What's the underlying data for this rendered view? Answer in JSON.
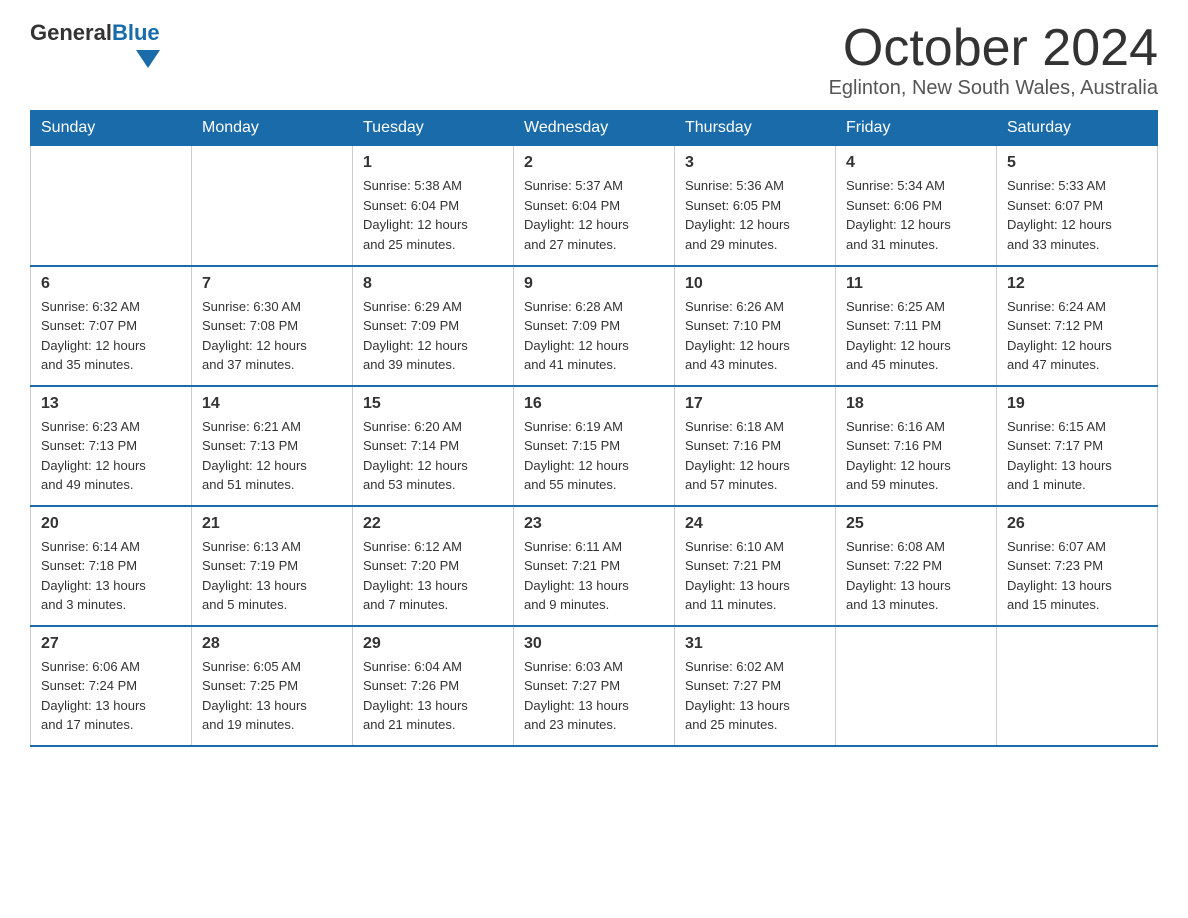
{
  "header": {
    "logo": {
      "general": "General",
      "blue": "Blue"
    },
    "title": "October 2024",
    "location": "Eglinton, New South Wales, Australia"
  },
  "calendar": {
    "days_of_week": [
      "Sunday",
      "Monday",
      "Tuesday",
      "Wednesday",
      "Thursday",
      "Friday",
      "Saturday"
    ],
    "weeks": [
      [
        {
          "day": "",
          "info": ""
        },
        {
          "day": "",
          "info": ""
        },
        {
          "day": "1",
          "info": "Sunrise: 5:38 AM\nSunset: 6:04 PM\nDaylight: 12 hours\nand 25 minutes."
        },
        {
          "day": "2",
          "info": "Sunrise: 5:37 AM\nSunset: 6:04 PM\nDaylight: 12 hours\nand 27 minutes."
        },
        {
          "day": "3",
          "info": "Sunrise: 5:36 AM\nSunset: 6:05 PM\nDaylight: 12 hours\nand 29 minutes."
        },
        {
          "day": "4",
          "info": "Sunrise: 5:34 AM\nSunset: 6:06 PM\nDaylight: 12 hours\nand 31 minutes."
        },
        {
          "day": "5",
          "info": "Sunrise: 5:33 AM\nSunset: 6:07 PM\nDaylight: 12 hours\nand 33 minutes."
        }
      ],
      [
        {
          "day": "6",
          "info": "Sunrise: 6:32 AM\nSunset: 7:07 PM\nDaylight: 12 hours\nand 35 minutes."
        },
        {
          "day": "7",
          "info": "Sunrise: 6:30 AM\nSunset: 7:08 PM\nDaylight: 12 hours\nand 37 minutes."
        },
        {
          "day": "8",
          "info": "Sunrise: 6:29 AM\nSunset: 7:09 PM\nDaylight: 12 hours\nand 39 minutes."
        },
        {
          "day": "9",
          "info": "Sunrise: 6:28 AM\nSunset: 7:09 PM\nDaylight: 12 hours\nand 41 minutes."
        },
        {
          "day": "10",
          "info": "Sunrise: 6:26 AM\nSunset: 7:10 PM\nDaylight: 12 hours\nand 43 minutes."
        },
        {
          "day": "11",
          "info": "Sunrise: 6:25 AM\nSunset: 7:11 PM\nDaylight: 12 hours\nand 45 minutes."
        },
        {
          "day": "12",
          "info": "Sunrise: 6:24 AM\nSunset: 7:12 PM\nDaylight: 12 hours\nand 47 minutes."
        }
      ],
      [
        {
          "day": "13",
          "info": "Sunrise: 6:23 AM\nSunset: 7:13 PM\nDaylight: 12 hours\nand 49 minutes."
        },
        {
          "day": "14",
          "info": "Sunrise: 6:21 AM\nSunset: 7:13 PM\nDaylight: 12 hours\nand 51 minutes."
        },
        {
          "day": "15",
          "info": "Sunrise: 6:20 AM\nSunset: 7:14 PM\nDaylight: 12 hours\nand 53 minutes."
        },
        {
          "day": "16",
          "info": "Sunrise: 6:19 AM\nSunset: 7:15 PM\nDaylight: 12 hours\nand 55 minutes."
        },
        {
          "day": "17",
          "info": "Sunrise: 6:18 AM\nSunset: 7:16 PM\nDaylight: 12 hours\nand 57 minutes."
        },
        {
          "day": "18",
          "info": "Sunrise: 6:16 AM\nSunset: 7:16 PM\nDaylight: 12 hours\nand 59 minutes."
        },
        {
          "day": "19",
          "info": "Sunrise: 6:15 AM\nSunset: 7:17 PM\nDaylight: 13 hours\nand 1 minute."
        }
      ],
      [
        {
          "day": "20",
          "info": "Sunrise: 6:14 AM\nSunset: 7:18 PM\nDaylight: 13 hours\nand 3 minutes."
        },
        {
          "day": "21",
          "info": "Sunrise: 6:13 AM\nSunset: 7:19 PM\nDaylight: 13 hours\nand 5 minutes."
        },
        {
          "day": "22",
          "info": "Sunrise: 6:12 AM\nSunset: 7:20 PM\nDaylight: 13 hours\nand 7 minutes."
        },
        {
          "day": "23",
          "info": "Sunrise: 6:11 AM\nSunset: 7:21 PM\nDaylight: 13 hours\nand 9 minutes."
        },
        {
          "day": "24",
          "info": "Sunrise: 6:10 AM\nSunset: 7:21 PM\nDaylight: 13 hours\nand 11 minutes."
        },
        {
          "day": "25",
          "info": "Sunrise: 6:08 AM\nSunset: 7:22 PM\nDaylight: 13 hours\nand 13 minutes."
        },
        {
          "day": "26",
          "info": "Sunrise: 6:07 AM\nSunset: 7:23 PM\nDaylight: 13 hours\nand 15 minutes."
        }
      ],
      [
        {
          "day": "27",
          "info": "Sunrise: 6:06 AM\nSunset: 7:24 PM\nDaylight: 13 hours\nand 17 minutes."
        },
        {
          "day": "28",
          "info": "Sunrise: 6:05 AM\nSunset: 7:25 PM\nDaylight: 13 hours\nand 19 minutes."
        },
        {
          "day": "29",
          "info": "Sunrise: 6:04 AM\nSunset: 7:26 PM\nDaylight: 13 hours\nand 21 minutes."
        },
        {
          "day": "30",
          "info": "Sunrise: 6:03 AM\nSunset: 7:27 PM\nDaylight: 13 hours\nand 23 minutes."
        },
        {
          "day": "31",
          "info": "Sunrise: 6:02 AM\nSunset: 7:27 PM\nDaylight: 13 hours\nand 25 minutes."
        },
        {
          "day": "",
          "info": ""
        },
        {
          "day": "",
          "info": ""
        }
      ]
    ]
  }
}
